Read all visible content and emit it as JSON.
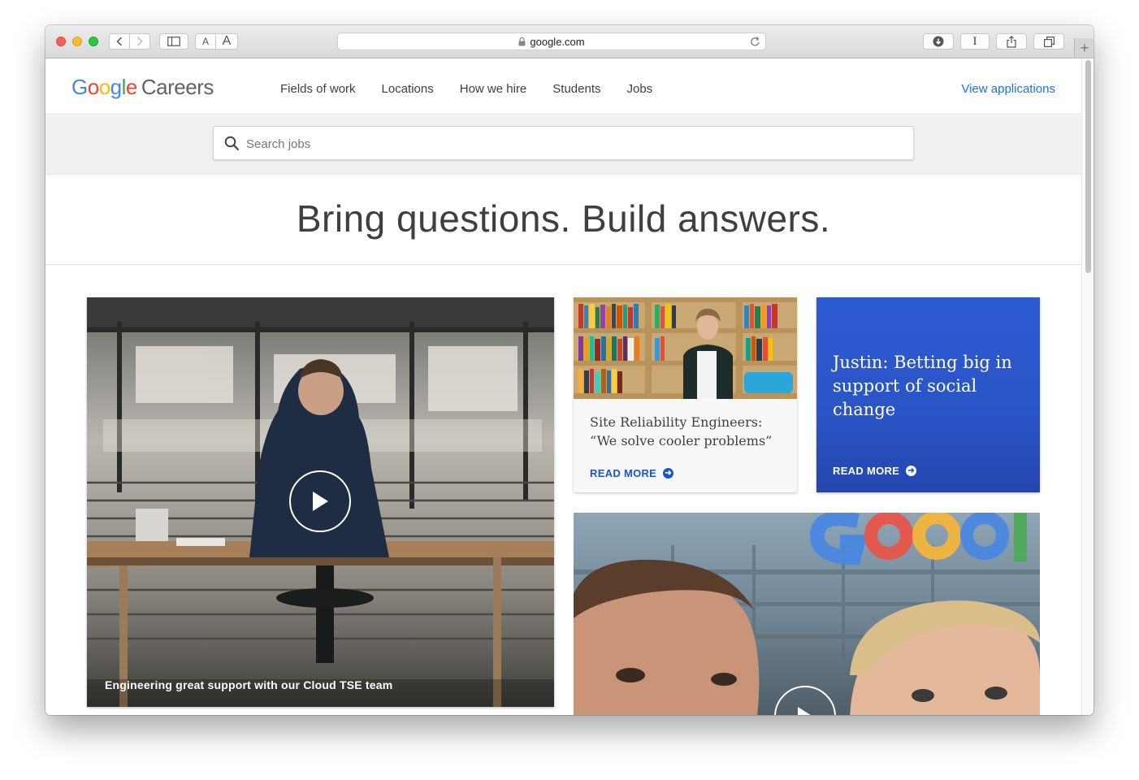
{
  "browser": {
    "url": "google.com"
  },
  "header": {
    "logo_google": "Google",
    "logo_careers": "Careers",
    "nav": [
      {
        "label": "Fields of work"
      },
      {
        "label": "Locations"
      },
      {
        "label": "How we hire"
      },
      {
        "label": "Students"
      },
      {
        "label": "Jobs"
      }
    ],
    "view_applications": "View applications"
  },
  "search": {
    "placeholder": "Search jobs"
  },
  "hero": {
    "title": "Bring questions. Build answers."
  },
  "cards": {
    "video": {
      "caption": "Engineering great support with our Cloud TSE team"
    },
    "sre": {
      "title": "Site Reliability Engineers: “We solve cooler problems”",
      "cta": "READ MORE"
    },
    "justin": {
      "title": "Justin: Betting big in support of social change",
      "cta": "READ MORE"
    }
  },
  "colors": {
    "link_blue": "#1a73e8",
    "cta_blue": "#1a56c8",
    "card_blue": "#2c5ad1"
  },
  "icons": [
    "back-chevron-icon",
    "forward-chevron-icon",
    "sidebar-icon",
    "lock-icon",
    "reload-icon",
    "download-icon",
    "reader-icon",
    "share-icon",
    "tabs-icon",
    "search-icon",
    "play-icon",
    "arrow-circle-right-icon"
  ]
}
